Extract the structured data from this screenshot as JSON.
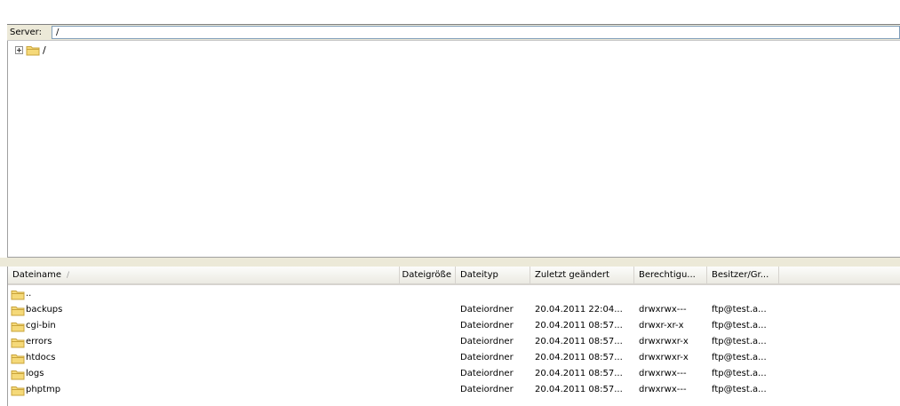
{
  "address_bar": {
    "label": "Server:",
    "path": "/"
  },
  "tree": {
    "root": {
      "label": "/",
      "icon": "folder-icon",
      "expander": "plus"
    }
  },
  "file_list": {
    "columns": [
      "Dateiname",
      "Dateigröße",
      "Dateityp",
      "Zuletzt geändert",
      "Berechtigu...",
      "Besitzer/Gr..."
    ],
    "sort_indicator": "/",
    "rows": [
      {
        "name": "..",
        "size": "",
        "type": "",
        "modified": "",
        "permissions": "",
        "owner": ""
      },
      {
        "name": "backups",
        "size": "",
        "type": "Dateiordner",
        "modified": "20.04.2011 22:04...",
        "permissions": "drwxrwx---",
        "owner": "ftp@test.a..."
      },
      {
        "name": "cgi-bin",
        "size": "",
        "type": "Dateiordner",
        "modified": "20.04.2011 08:57...",
        "permissions": "drwxr-xr-x",
        "owner": "ftp@test.a..."
      },
      {
        "name": "errors",
        "size": "",
        "type": "Dateiordner",
        "modified": "20.04.2011 08:57...",
        "permissions": "drwxrwxr-x",
        "owner": "ftp@test.a..."
      },
      {
        "name": "htdocs",
        "size": "",
        "type": "Dateiordner",
        "modified": "20.04.2011 08:57...",
        "permissions": "drwxrwxr-x",
        "owner": "ftp@test.a..."
      },
      {
        "name": "logs",
        "size": "",
        "type": "Dateiordner",
        "modified": "20.04.2011 08:57...",
        "permissions": "drwxrwx---",
        "owner": "ftp@test.a..."
      },
      {
        "name": "phptmp",
        "size": "",
        "type": "Dateiordner",
        "modified": "20.04.2011 08:57...",
        "permissions": "drwxrwx---",
        "owner": "ftp@test.a..."
      }
    ]
  },
  "colors": {
    "folder": "#f5d979",
    "folder_border": "#c9a43b",
    "panel": "#ece9d8"
  }
}
